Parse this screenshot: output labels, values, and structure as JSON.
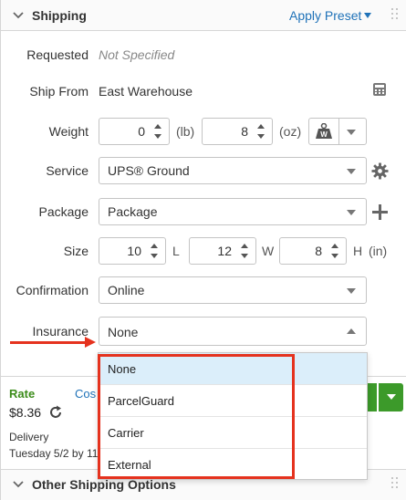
{
  "header": {
    "title": "Shipping",
    "apply_preset": "Apply Preset"
  },
  "requested": {
    "label": "Requested",
    "value": "Not Specified"
  },
  "ship_from": {
    "label": "Ship From",
    "value": "East Warehouse",
    "icon": "calculator-icon"
  },
  "weight": {
    "label": "Weight",
    "lb_value": "0",
    "lb_unit": "(lb)",
    "oz_value": "8",
    "oz_unit": "(oz)",
    "scale_icon": "scale-weight-icon"
  },
  "service": {
    "label": "Service",
    "value": "UPS® Ground",
    "icon": "gear-icon"
  },
  "package": {
    "label": "Package",
    "value": "Package",
    "icon": "plus-icon"
  },
  "size": {
    "label": "Size",
    "length": "10",
    "l_unit": "L",
    "width": "12",
    "w_unit": "W",
    "height": "8",
    "h_unit": "H",
    "unit": "(in)"
  },
  "confirmation": {
    "label": "Confirmation",
    "value": "Online"
  },
  "insurance": {
    "label": "Insurance",
    "value": "None",
    "options": [
      "None",
      "ParcelGuard",
      "Carrier",
      "External"
    ],
    "selected_index": 0
  },
  "rate": {
    "label": "Rate",
    "value": "$8.36",
    "cost_link": "Cos"
  },
  "delivery": {
    "label": "Delivery",
    "value": "Tuesday 5/2 by 11"
  },
  "footer": {
    "title": "Other Shipping Options"
  },
  "colors": {
    "link": "#1f72b8",
    "accent_green": "#3c9a2a",
    "highlight_red": "#e5321e",
    "selected_bg": "#dbeefa"
  }
}
